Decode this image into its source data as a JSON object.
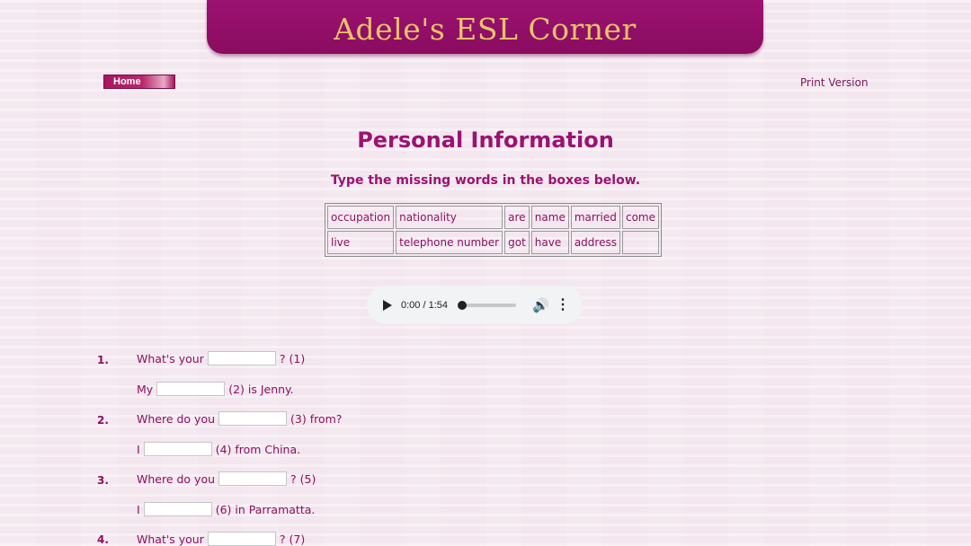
{
  "header": {
    "title": "Adele's ESL Corner"
  },
  "nav": {
    "home_label": "Home",
    "print_label": "Print Version"
  },
  "page": {
    "title": "Personal Information",
    "instruction": "Type the missing words in the boxes below."
  },
  "word_bank": [
    [
      "occupation",
      "nationality",
      "are",
      "name",
      "married",
      "come"
    ],
    [
      "live",
      "telephone number",
      "got",
      "have",
      "address",
      ""
    ]
  ],
  "audio": {
    "time": "0:00 / 1:54",
    "progress": 0
  },
  "questions": [
    {
      "num": "1.",
      "q_before": "What's your",
      "q_after": "? (1)",
      "a_before": "My",
      "a_after": "(2) is Jenny."
    },
    {
      "num": "2.",
      "q_before": "Where do you",
      "q_after": "(3) from?",
      "a_before": "I",
      "a_after": "(4) from China."
    },
    {
      "num": "3.",
      "q_before": "Where do you",
      "q_after": "? (5)",
      "a_before": "I",
      "a_after": "(6) in Parramatta."
    },
    {
      "num": "4.",
      "q_before": "What's your",
      "q_after": "? (7)"
    }
  ]
}
